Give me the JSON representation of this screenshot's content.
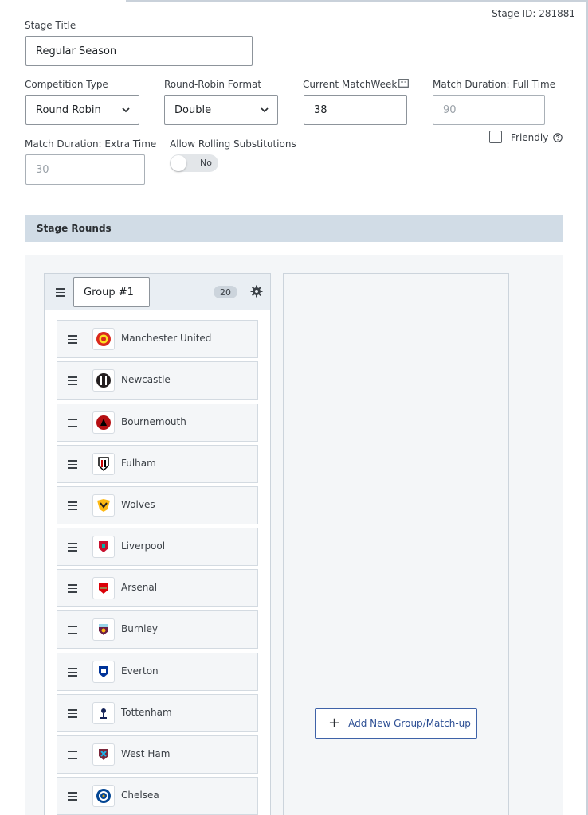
{
  "stage_id": "Stage ID: 281881",
  "stage_title": {
    "label": "Stage Title",
    "value": "Regular Season"
  },
  "competition_type": {
    "label": "Competition Type",
    "value": "Round Robin"
  },
  "round_robin_format": {
    "label": "Round-Robin Format",
    "value": "Double"
  },
  "current_matchweek": {
    "label": "Current MatchWeek",
    "value": "38",
    "icon": "calendar-icon"
  },
  "full_time": {
    "label": "Match Duration: Full Time",
    "placeholder": "90"
  },
  "friendly": {
    "label": "Friendly",
    "checked": false,
    "icon": "help-icon"
  },
  "extra_time": {
    "label": "Match Duration: Extra Time",
    "placeholder": "30"
  },
  "rolling_subs": {
    "label": "Allow Rolling Substitutions",
    "state": "No"
  },
  "stage_rounds": {
    "title": "Stage Rounds"
  },
  "group": {
    "name": "Group #1",
    "count": "20",
    "teams": [
      {
        "name": "Manchester United",
        "color": "#da291c",
        "accent": "#fbe122"
      },
      {
        "name": "Newcastle",
        "color": "#241f20",
        "accent": "#ffffff"
      },
      {
        "name": "Bournemouth",
        "color": "#b50e12",
        "accent": "#000000"
      },
      {
        "name": "Fulham",
        "color": "#000000",
        "accent": "#cc0000"
      },
      {
        "name": "Wolves",
        "color": "#fdb913",
        "accent": "#231f20"
      },
      {
        "name": "Liverpool",
        "color": "#c8102e",
        "accent": "#00b2a9"
      },
      {
        "name": "Arsenal",
        "color": "#db0007",
        "accent": "#9c824a"
      },
      {
        "name": "Burnley",
        "color": "#6c1d45",
        "accent": "#99d6ea"
      },
      {
        "name": "Everton",
        "color": "#003399",
        "accent": "#ffffff"
      },
      {
        "name": "Tottenham",
        "color": "#132257",
        "accent": "#ffffff"
      },
      {
        "name": "West Ham",
        "color": "#7a263a",
        "accent": "#1bb1e7"
      },
      {
        "name": "Chelsea",
        "color": "#034694",
        "accent": "#dba111"
      }
    ]
  },
  "add_group_button": {
    "label": "Add New Group/Match-up"
  },
  "colors": {
    "section_header": "#d1dce6",
    "primary_button": "#3e62a8"
  }
}
